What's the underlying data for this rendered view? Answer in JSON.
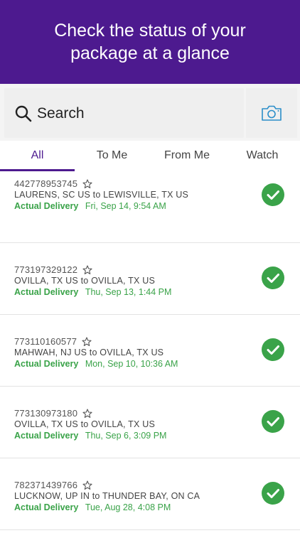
{
  "hero": {
    "title": "Check the status of your package at a glance"
  },
  "search": {
    "label": "Search"
  },
  "tabs": [
    {
      "label": "All"
    },
    {
      "label": "To Me"
    },
    {
      "label": "From Me"
    },
    {
      "label": "Watch"
    }
  ],
  "active_tab": "All",
  "colors": {
    "brand": "#4d1a8f",
    "delivered": "#3aa349",
    "camera": "#2b8ec9"
  },
  "shipments": [
    {
      "tracking": "442778953745",
      "route": "LAURENS, SC US to LEWISVILLE, TX US",
      "status": "Actual Delivery",
      "date": "Fri, Sep 14, 9:54 AM"
    },
    {
      "tracking": "773197329122",
      "route": "OVILLA, TX US to OVILLA, TX US",
      "status": "Actual Delivery",
      "date": "Thu, Sep 13, 1:44 PM"
    },
    {
      "tracking": "773110160577",
      "route": "MAHWAH, NJ US to OVILLA, TX US",
      "status": "Actual Delivery",
      "date": "Mon, Sep 10, 10:36 AM"
    },
    {
      "tracking": "773130973180",
      "route": "OVILLA, TX US to OVILLA, TX US",
      "status": "Actual Delivery",
      "date": "Thu, Sep 6, 3:09 PM"
    },
    {
      "tracking": "782371439766",
      "route": "LUCKNOW, UP IN to THUNDER BAY, ON CA",
      "status": "Actual Delivery",
      "date": "Tue, Aug 28, 4:08 PM"
    }
  ]
}
